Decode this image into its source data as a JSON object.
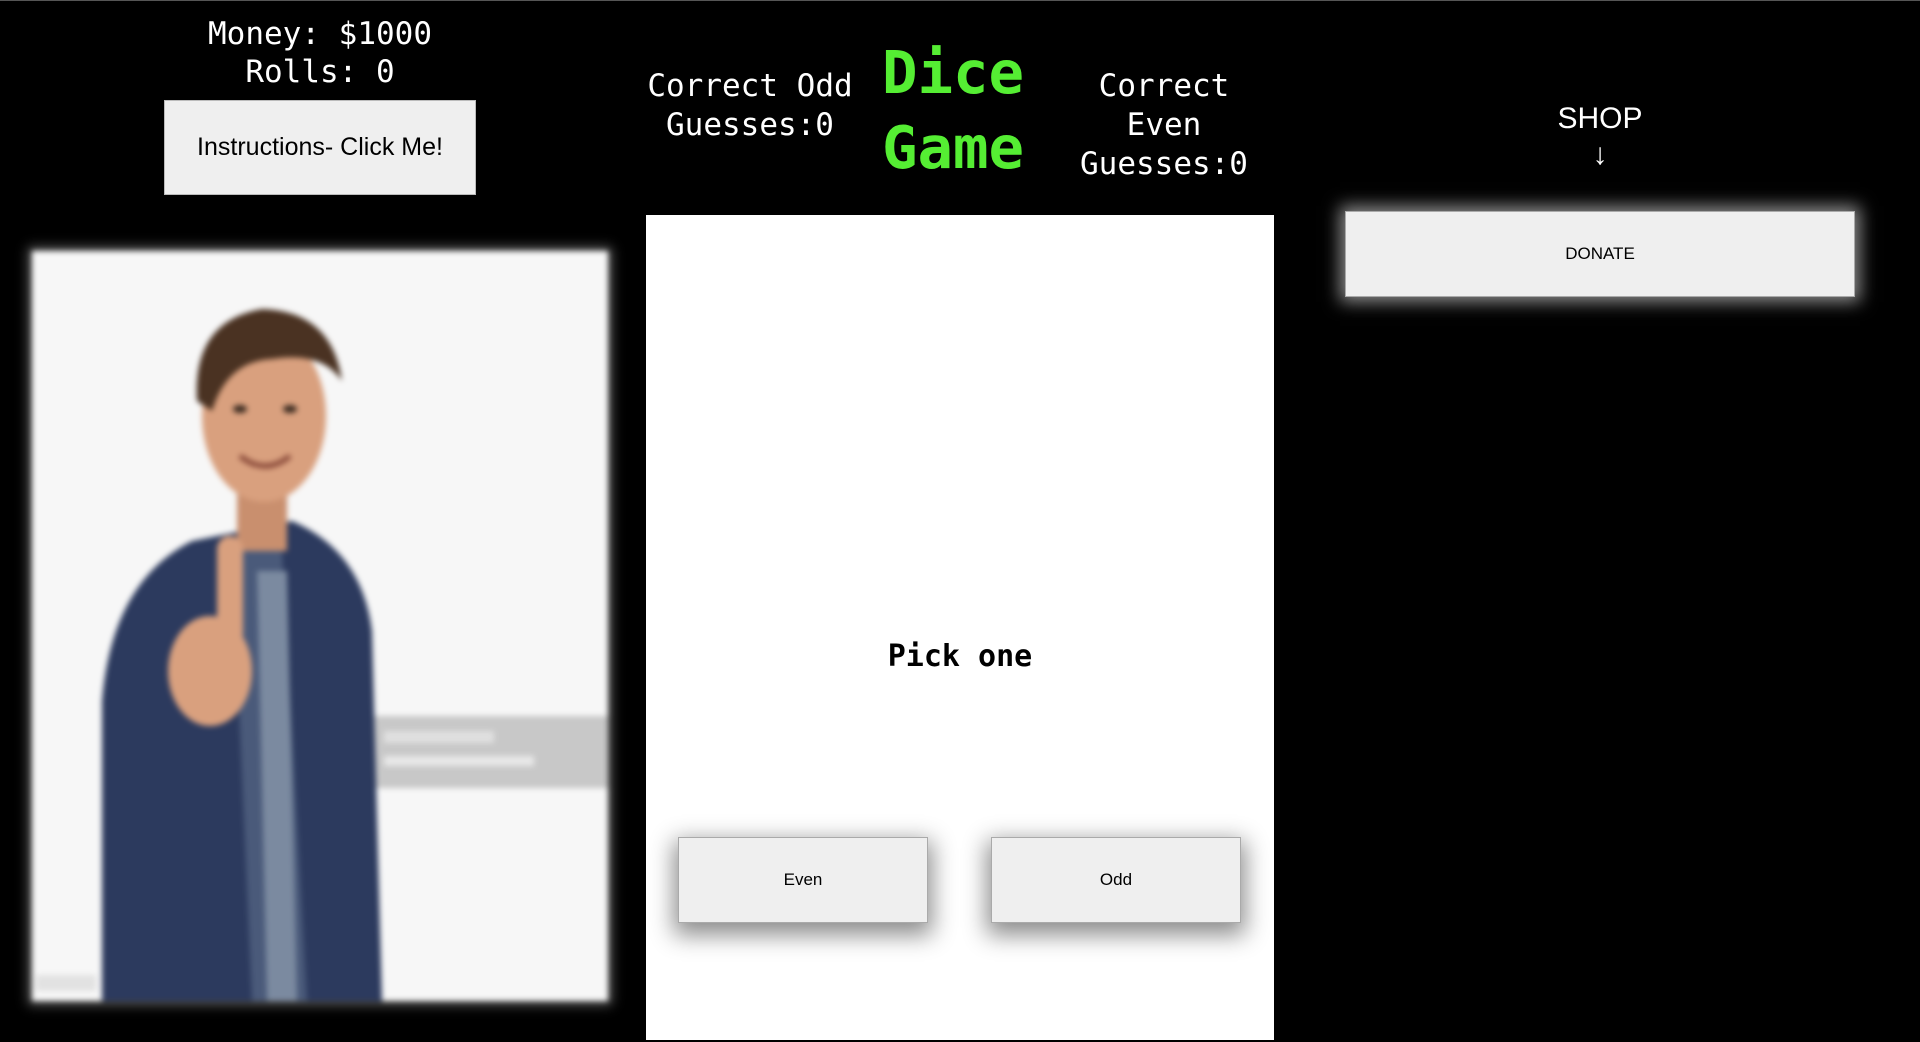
{
  "stats": {
    "money": "Money: $1000",
    "rolls": "Rolls: 0"
  },
  "instructions_label": "Instructions- Click Me!",
  "counters": {
    "odd_line1": "Correct Odd",
    "odd_line2": "Guesses:0",
    "even_line1": "Correct Even",
    "even_line2": "Guesses:0"
  },
  "title": {
    "line1": "Dice",
    "line2": "Game"
  },
  "game": {
    "prompt": "Pick one",
    "even_label": "Even",
    "odd_label": "Odd"
  },
  "shop": {
    "label": "SHOP",
    "arrow": "↓",
    "donate_label": "DONATE"
  },
  "colors": {
    "background": "#000000",
    "title_green": "#55ee33",
    "button_bg": "#efefef"
  }
}
